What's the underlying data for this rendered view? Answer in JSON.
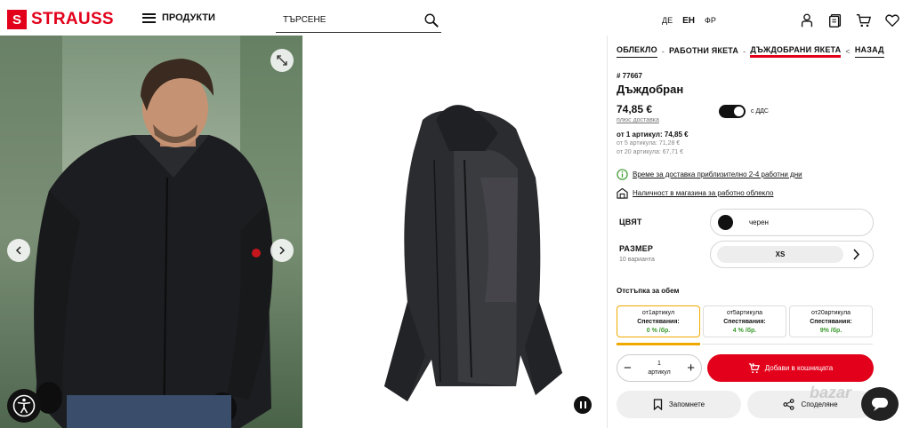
{
  "header": {
    "logo_letter": "S",
    "logo_text": "STRAUSS",
    "menu_label": "ПРОДУКТИ",
    "search_placeholder": "ТЪРСЕНЕ",
    "languages": [
      "ДЕ",
      "ЕН",
      "ФР"
    ],
    "active_language": "ЕН"
  },
  "gallery": {
    "pause": true
  },
  "breadcrumb": {
    "items": [
      "ОБЛЕКЛО",
      "РАБОТНИ ЯКЕТА",
      "ДЪЖДОБРАНИ ЯКЕТА"
    ],
    "arrow": "<",
    "back": "НАЗАД"
  },
  "product": {
    "article": "# 77667",
    "title": "Дъждобран",
    "price": "74,85 €",
    "shipping": "плюс доставка",
    "vat_label": "с ДДС",
    "tier_main": "от 1 артикул: 74,85 €",
    "tier_5": "от 5 артикула: 71,28 €",
    "tier_20": "от 20 артикула: 67,71 €",
    "delivery": "Време за доставка приблизително 2-4 работни дни",
    "store": "Наличност в магазина за работно облекло"
  },
  "options": {
    "color_label": "ЦВЯТ",
    "color_value": "черен",
    "size_label": "РАЗМЕР",
    "size_variants": "10 варианта",
    "size_value": "XS"
  },
  "volume": {
    "title": "Отстъпка за обем",
    "cards": [
      {
        "qty": "от1артикул",
        "label": "Спестявания:",
        "pct": "0 % /бр."
      },
      {
        "qty": "от5артикула",
        "label": "Спестявания:",
        "pct": "4 % /бр."
      },
      {
        "qty": "от20артикула",
        "label": "Спестявания:",
        "pct": "9% /бр."
      }
    ]
  },
  "cart": {
    "qty": "1",
    "unit": "артикул",
    "add_label": "Добави в кошницата",
    "remember": "Запомнете",
    "share": "Споделяне"
  },
  "colors": {
    "brand": "#e2001a",
    "accent": "#f0a900",
    "green": "#3c9a2f"
  },
  "watermark": "bazar"
}
